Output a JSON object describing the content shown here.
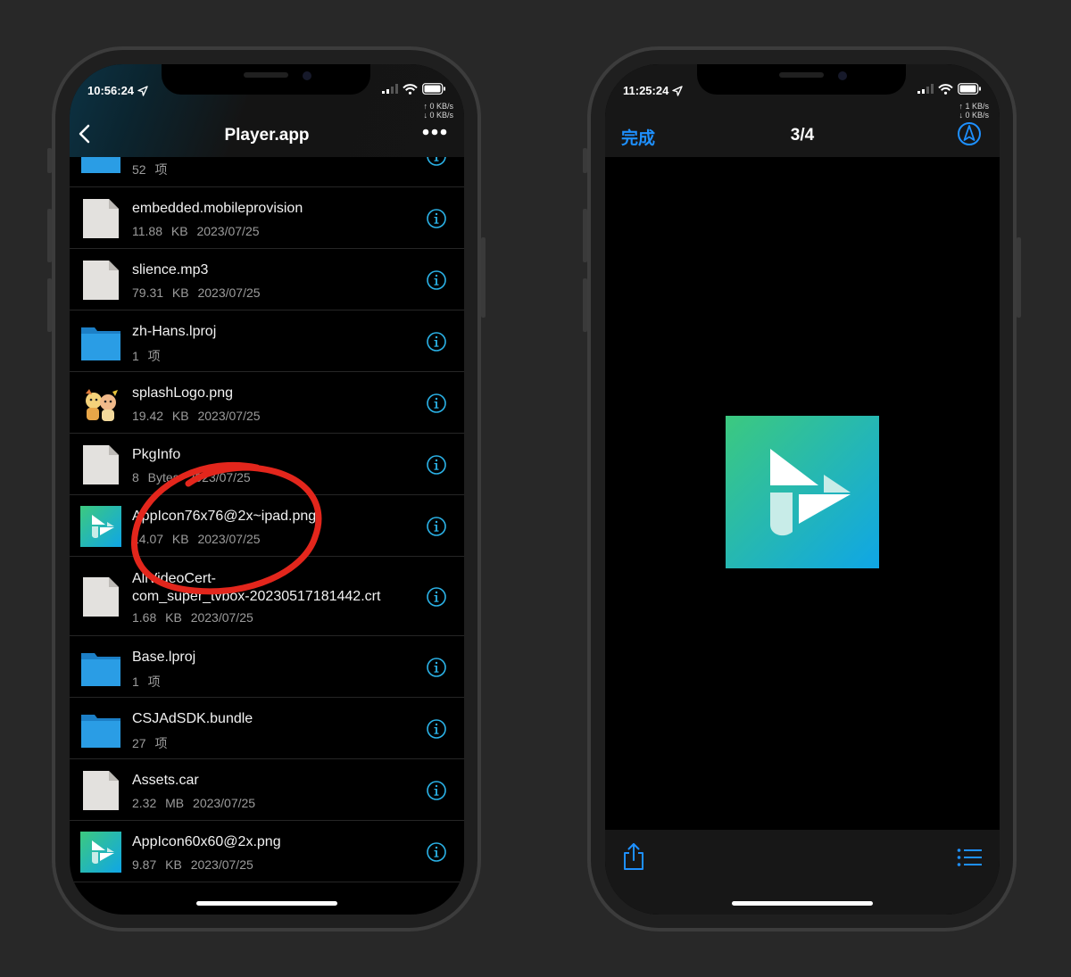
{
  "colors": {
    "accent": "#1e90ff",
    "folder": "#2a9de5",
    "info_icon": "#2bb3e8",
    "annotation": "#e3261c",
    "app_icon_gradient": [
      "#3cc97f",
      "#0fa6e6"
    ]
  },
  "left_phone": {
    "status": {
      "time": "10:56:24",
      "up_speed": "↑ 0 KB/s",
      "down_speed": "↓ 0 KB/s"
    },
    "nav": {
      "back_icon": "chevron-left-icon",
      "title": "Player.app",
      "more_icon": "more-horizontal-icon"
    },
    "files": [
      {
        "name": "",
        "meta": "52 项",
        "type": "folder",
        "partial": true
      },
      {
        "name": "embedded.mobileprovision",
        "meta": "11.88 KB 2023/07/25",
        "type": "file"
      },
      {
        "name": "slience.mp3",
        "meta": "79.31 KB 2023/07/25",
        "type": "file"
      },
      {
        "name": "zh-Hans.lproj",
        "meta": "1 项",
        "type": "folder"
      },
      {
        "name": "splashLogo.png",
        "meta": "19.42 KB 2023/07/25",
        "type": "image-mascot"
      },
      {
        "name": "PkgInfo",
        "meta": "8 Bytes 2023/07/25",
        "type": "file"
      },
      {
        "name": "AppIcon76x76@2x~ipad.png",
        "meta": "14.07 KB 2023/07/25",
        "type": "image-appicon"
      },
      {
        "name": "AliVideoCert-",
        "name2": "com_super_tvbox-20230517181442.crt",
        "meta": "1.68 KB 2023/07/25",
        "type": "file",
        "tall": true
      },
      {
        "name": "Base.lproj",
        "meta": "1 项",
        "type": "folder"
      },
      {
        "name": "CSJAdSDK.bundle",
        "meta": "27 项",
        "type": "folder"
      },
      {
        "name": "Assets.car",
        "meta": "2.32 MB 2023/07/25",
        "type": "file"
      },
      {
        "name": "AppIcon60x60@2x.png",
        "meta": "9.87 KB 2023/07/25",
        "type": "image-appicon"
      }
    ]
  },
  "right_phone": {
    "status": {
      "time": "11:25:24",
      "up_speed": "↑ 1 KB/s",
      "down_speed": "↓ 0 KB/s"
    },
    "nav": {
      "done_label": "完成",
      "title": "3/4",
      "markup_icon": "compass-icon"
    },
    "preview_icon": "app-icon-preview",
    "toolbar": {
      "share_icon": "share-icon",
      "list_icon": "list-icon"
    }
  }
}
